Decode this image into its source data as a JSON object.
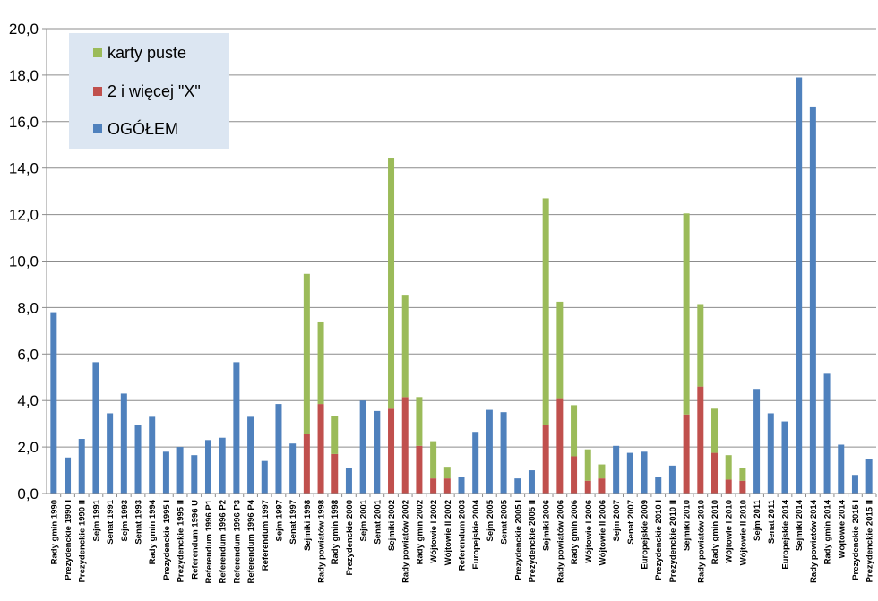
{
  "chart_data": {
    "type": "bar",
    "stacked": true,
    "ylim": [
      0,
      20
    ],
    "yticks": [
      "0,0",
      "2,0",
      "4,0",
      "6,0",
      "8,0",
      "10,0",
      "12,0",
      "14,0",
      "16,0",
      "18,0",
      "20,0"
    ],
    "grid": true,
    "legend_position": "top-left",
    "legend": [
      "karty puste",
      "2 i więcej \"X\"",
      "OGÓŁEM"
    ],
    "categories": [
      "Rady gmin 1990",
      "Prezydenckie 1990 I",
      "Prezydenckie 1990 II",
      "Sejm 1991",
      "Senat 1991",
      "Sejm 1993",
      "Senat 1993",
      "Rady gmin 1994",
      "Prezydenckie 1995 I",
      "Prezydenckie 1995 II",
      "Referendum 1996 U",
      "Referendum 1996 P1",
      "Referendum 1996 P2",
      "Referendum 1996 P3",
      "Referendum 1996 P4",
      "Referendum 1997",
      "Sejm 1997",
      "Senat 1997",
      "Sejmiki 1998",
      "Rady powiatów 1998",
      "Rady gmin 1998",
      "Prezydenckie 2000",
      "Sejm 2001",
      "Senat 2001",
      "Sejmiki 2002",
      "Rady powiatów 2002",
      "Rady gmin 2002",
      "Wójtowie I 2002",
      "Wójtowie II 2002",
      "Referendum 2003",
      "Europejskie 2004",
      "Sejm 2005",
      "Senat 2005",
      "Prezydenckie 2005 I",
      "Prezydenckie 2005 II",
      "Sejmiki 2006",
      "Rady powiatów 2006",
      "Rady gmin 2006",
      "Wójtowie I 2006",
      "Wójtowie II 2006",
      "Sejm 2007",
      "Senat 2007",
      "Europejskie 2009",
      "Prezydenckie 2010 I",
      "Prezydenckie 2010 II",
      "Sejmiki 2010",
      "Rady powiatów 2010",
      "Rady gmin 2010",
      "Wójtowie I 2010",
      "Wójtowie II 2010",
      "Sejm 2011",
      "Senat 2011",
      "Europejskie 2014",
      "Sejmiki 2014",
      "Rady powiatów 2014",
      "Rady gmin 2014",
      "Wójtowie 2014",
      "Prezydenckie 2015 I",
      "Prezydenckie 2015 II"
    ],
    "series": [
      {
        "name": "OGÓŁEM",
        "color": "#4f81bd",
        "values": [
          7.8,
          1.55,
          2.35,
          5.65,
          3.45,
          4.3,
          2.95,
          3.3,
          1.8,
          2.0,
          1.65,
          2.3,
          2.4,
          5.65,
          3.3,
          1.4,
          3.85,
          2.15,
          0,
          0,
          0,
          1.1,
          4.0,
          3.55,
          0,
          0,
          0,
          0,
          0,
          0.7,
          2.65,
          3.6,
          3.5,
          0.65,
          1.0,
          0,
          0,
          0,
          0,
          0,
          2.05,
          1.75,
          1.8,
          0.7,
          1.2,
          0,
          0,
          0,
          0,
          0,
          4.5,
          3.45,
          3.1,
          17.9,
          16.65,
          5.15,
          2.1,
          0.8,
          1.5
        ]
      },
      {
        "name": "2 i więcej \"X\"",
        "color": "#c0504d",
        "values": [
          0,
          0,
          0,
          0,
          0,
          0,
          0,
          0,
          0,
          0,
          0,
          0,
          0,
          0,
          0,
          0,
          0,
          0,
          2.55,
          3.85,
          1.7,
          0,
          0,
          0,
          3.65,
          4.15,
          2.05,
          0.65,
          0.65,
          0,
          0,
          0,
          0,
          0,
          0,
          2.95,
          4.1,
          1.6,
          0.55,
          0.65,
          0,
          0,
          0,
          0,
          0,
          3.4,
          4.6,
          1.75,
          0.6,
          0.55,
          0,
          0,
          0,
          0,
          0,
          0,
          0,
          0,
          0
        ]
      },
      {
        "name": "karty puste",
        "color": "#9bbb59",
        "values": [
          0,
          0,
          0,
          0,
          0,
          0,
          0,
          0,
          0,
          0,
          0,
          0,
          0,
          0,
          0,
          0,
          0,
          0,
          6.9,
          3.55,
          1.65,
          0,
          0,
          0,
          10.8,
          4.4,
          2.1,
          1.6,
          0.5,
          0,
          0,
          0,
          0,
          0,
          0,
          9.75,
          4.15,
          2.2,
          1.35,
          0.6,
          0,
          0,
          0,
          0,
          0,
          8.65,
          3.55,
          1.9,
          1.05,
          0.55,
          0,
          0,
          0,
          0,
          0,
          0,
          0,
          0,
          0
        ]
      }
    ]
  }
}
